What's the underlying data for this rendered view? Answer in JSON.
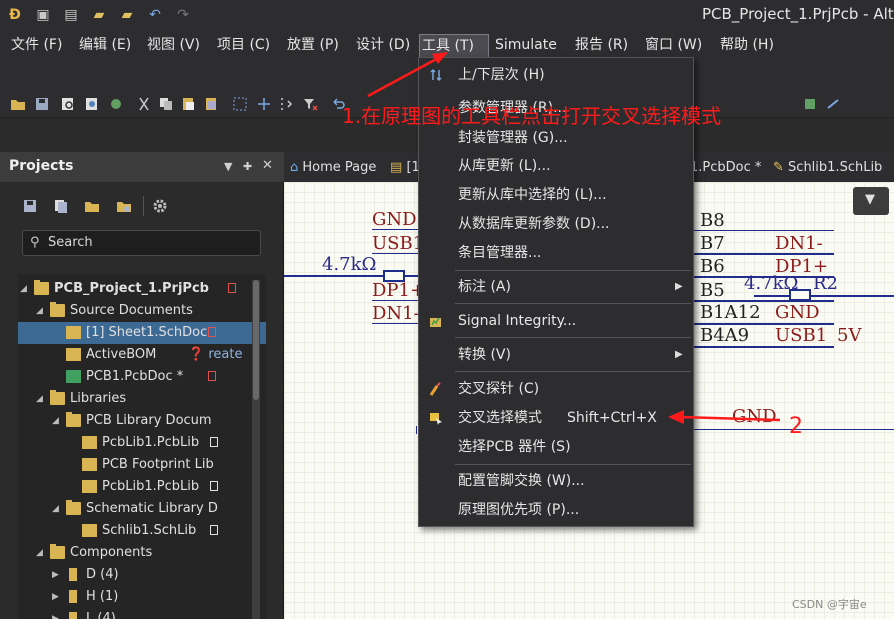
{
  "window": {
    "title": "PCB_Project_1.PrjPcb - Alti"
  },
  "menubar": {
    "items": [
      "文件 (F)",
      "编辑 (E)",
      "视图 (V)",
      "项目 (C)",
      "放置 (P)",
      "设计 (D)",
      "工具 (T)",
      "Simulate",
      "报告 (R)",
      "窗口 (W)",
      "帮助 (H)"
    ],
    "active": "工具 (T)"
  },
  "projects_panel": {
    "title": "Projects",
    "search_placeholder": "Search",
    "tree": [
      {
        "label": "PCB_Project_1.PrjPcb",
        "level": 0,
        "expanded": true,
        "selected_outline": true
      },
      {
        "label": "Source Documents",
        "level": 1,
        "expanded": true
      },
      {
        "label": "[1] Sheet1.SchDoc",
        "level": 2,
        "selected": true
      },
      {
        "label": "ActiveBOM",
        "level": 2,
        "extra": "reate"
      },
      {
        "label": "PCB1.PcbDoc *",
        "level": 2
      },
      {
        "label": "Libraries",
        "level": 1,
        "expanded": true
      },
      {
        "label": "PCB Library Docum",
        "level": 2,
        "expanded": true
      },
      {
        "label": "PcbLib1.PcbLib",
        "level": 3
      },
      {
        "label": "PCB Footprint Lib",
        "level": 3
      },
      {
        "label": "PcbLib1.PcbLib",
        "level": 3
      },
      {
        "label": "Schematic Library D",
        "level": 2,
        "expanded": true
      },
      {
        "label": "Schlib1.SchLib",
        "level": 3
      },
      {
        "label": "Components",
        "level": 1,
        "expanded": true
      },
      {
        "label": "D (4)",
        "level": 2
      },
      {
        "label": "H (1)",
        "level": 2
      },
      {
        "label": "L (4)",
        "level": 2
      }
    ]
  },
  "doc_tabs": [
    {
      "label": "Home Page"
    },
    {
      "label": "[1"
    },
    {
      "label": "1.PcbDoc *"
    },
    {
      "label": "Schlib1.SchLib"
    }
  ],
  "tools_menu": [
    {
      "label": "上/下层次 (H)",
      "icon": "hierarchy-icon"
    },
    {
      "label": "参数管理器 (R)..."
    },
    {
      "label": "封装管理器 (G)..."
    },
    {
      "label": "从库更新 (L)..."
    },
    {
      "label": "更新从库中选择的 (L)..."
    },
    {
      "label": "从数据库更新参数 (D)..."
    },
    {
      "label": "条目管理器..."
    },
    {
      "label": "标注 (A)",
      "submenu": true
    },
    {
      "label": "Signal Integrity...",
      "icon": "signal-integrity-icon"
    },
    {
      "label": "转换 (V)",
      "submenu": true
    },
    {
      "label": "交叉探针 (C)",
      "icon": "cross-probe-icon"
    },
    {
      "label": "交叉选择模式",
      "shortcut": "Shift+Ctrl+X",
      "icon": "cross-select-icon"
    },
    {
      "label": "选择PCB 器件 (S)"
    },
    {
      "label": "配置管脚交换 (W)..."
    },
    {
      "label": "原理图优先项 (P)..."
    }
  ],
  "schematic": {
    "labels": {
      "gnd_left": "GND",
      "usb_left": "USB1",
      "res_left": "4.7kΩ",
      "dp_left": "DP1+",
      "dn_left": "DN1-",
      "b8": "B8",
      "b7": "B7",
      "b6": "B6",
      "b5": "B5",
      "b1a12": "B1A12",
      "b4a9": "B4A9",
      "dn_right": "DN1-",
      "dp_right": "DP1+",
      "res_right": "4.7kΩ",
      "r2": "R2",
      "gnd_right": "GND",
      "usb_right": "USB1",
      "v5": "5V",
      "gnd_lower": "GND"
    }
  },
  "annotations": {
    "step1": "1.在原理图的工具栏点击打开交叉选择模式",
    "step2": "2",
    "color": "#ff1a1a"
  },
  "watermark": "CSDN @宇宙e"
}
